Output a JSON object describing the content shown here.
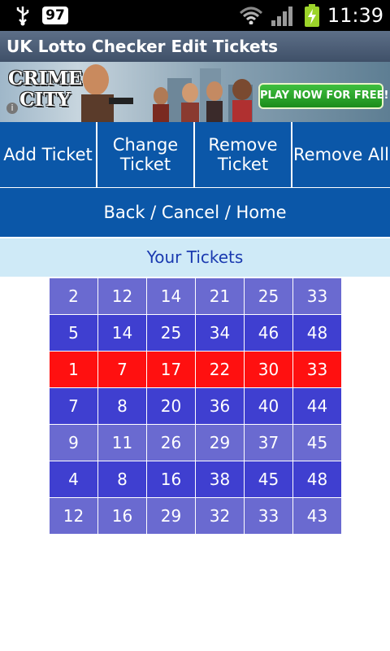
{
  "status_bar": {
    "badge": "97",
    "time": "11:39"
  },
  "title_bar": {
    "title": "UK Lotto Checker Edit Tickets"
  },
  "ad": {
    "logo_line1": "CRIME",
    "logo_line2": "CITY",
    "info": "i",
    "cta": "PLAY NOW FOR FREE!"
  },
  "buttons": {
    "add": "Add Ticket",
    "change_l1": "Change",
    "change_l2": "Ticket",
    "remove_l1": "Remove",
    "remove_l2": "Ticket",
    "remove_all": "Remove All",
    "back": "Back / Cancel / Home"
  },
  "tickets_header": "Your Tickets",
  "tickets": [
    [
      "2",
      "12",
      "14",
      "21",
      "25",
      "33"
    ],
    [
      "5",
      "14",
      "25",
      "34",
      "46",
      "48"
    ],
    [
      "1",
      "7",
      "17",
      "22",
      "30",
      "33"
    ],
    [
      "7",
      "8",
      "20",
      "36",
      "40",
      "44"
    ],
    [
      "9",
      "11",
      "26",
      "29",
      "37",
      "45"
    ],
    [
      "4",
      "8",
      "16",
      "38",
      "45",
      "48"
    ],
    [
      "12",
      "16",
      "29",
      "32",
      "33",
      "43"
    ]
  ],
  "colors": {
    "button_blue": "#0b57a8",
    "row_light": "#6a6ad0",
    "row_dark": "#3f3fd0",
    "row_highlight": "#ff1010",
    "header_bg": "#cfeaf7"
  }
}
